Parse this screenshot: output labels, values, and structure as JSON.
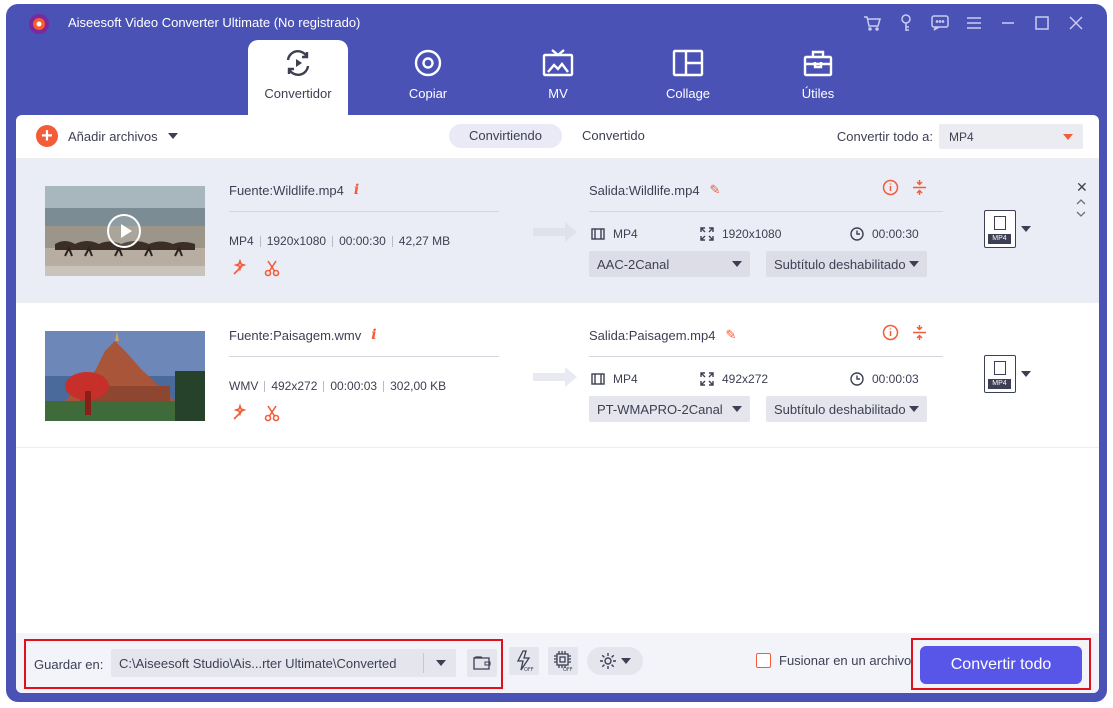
{
  "window": {
    "title": "Aiseesoft Video Converter Ultimate (No registrado)"
  },
  "tabs": [
    {
      "label": "Convertidor",
      "icon": "convert-icon",
      "active": true
    },
    {
      "label": "Copiar",
      "icon": "disc-icon"
    },
    {
      "label": "MV",
      "icon": "tv-icon"
    },
    {
      "label": "Collage",
      "icon": "collage-icon"
    },
    {
      "label": "Útiles",
      "icon": "toolbox-icon"
    }
  ],
  "toolbar": {
    "add_label": "Añadir archivos",
    "seg_converting": "Convirtiendo",
    "seg_converted": "Convertido",
    "convert_all_label": "Convertir todo a:",
    "convert_all_value": "MP4"
  },
  "files": [
    {
      "source_label": "Fuente:Wildlife.mp4",
      "src_format": "MP4",
      "src_resolution": "1920x1080",
      "src_duration": "00:00:30",
      "src_size": "42,27 MB",
      "output_label": "Salida:Wildlife.mp4",
      "out_format": "MP4",
      "out_resolution": "1920x1080",
      "out_duration": "00:00:30",
      "audio": "AAC-2Canal",
      "subtitle": "Subtítulo deshabilitado",
      "format_badge": "MP4"
    },
    {
      "source_label": "Fuente:Paisagem.wmv",
      "src_format": "WMV",
      "src_resolution": "492x272",
      "src_duration": "00:00:03",
      "src_size": "302,00 KB",
      "output_label": "Salida:Paisagem.mp4",
      "out_format": "MP4",
      "out_resolution": "492x272",
      "out_duration": "00:00:03",
      "audio": "PT-WMAPRO-2Canal",
      "subtitle": "Subtítulo deshabilitado",
      "format_badge": "MP4"
    }
  ],
  "bottom": {
    "save_label": "Guardar en:",
    "save_path": "C:\\Aiseesoft Studio\\Ais...rter Ultimate\\Converted",
    "merge_label": "Fusionar en un archivo",
    "convert_button": "Convertir todo"
  },
  "colors": {
    "primary": "#4a52b5",
    "accent": "#f35c39",
    "button": "#5756e8",
    "highlight_border": "#e0101c"
  }
}
